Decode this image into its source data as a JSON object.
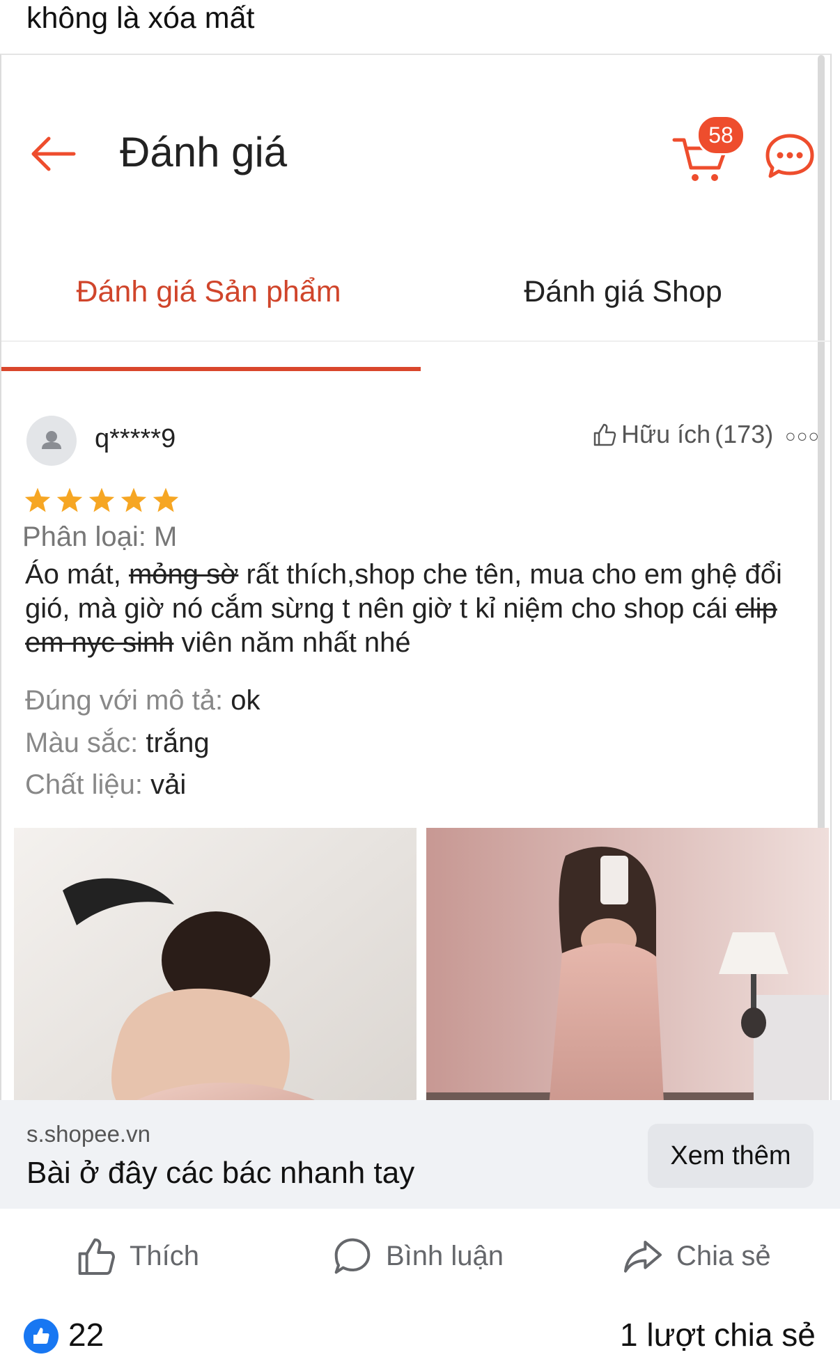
{
  "post": {
    "caption": "không là xóa mất"
  },
  "app": {
    "header_title": "Đánh giá",
    "cart_badge": "58",
    "accent_color": "#ee4d2d",
    "tabs": [
      {
        "label": "Đánh giá Sản phẩm",
        "active": true
      },
      {
        "label": "Đánh giá Shop",
        "active": false
      }
    ]
  },
  "review": {
    "username": "q*****9",
    "helpful_label": "Hữu ích",
    "helpful_count": "(173)",
    "rating": 5,
    "variant": "Phân loại: M",
    "comment": {
      "p1": "Áo mát, ",
      "s1": "mỏng sờ",
      "p2": " rất thích,shop che tên, mua cho em ghệ đổi gió, mà giờ nó cắm sừng t nên giờ t kỉ niệm cho shop cái ",
      "s2": "clip em nyc sinh",
      "p3": " viên năm nhất nhé"
    },
    "attributes": [
      {
        "label": "Đúng với mô tả: ",
        "value": "ok"
      },
      {
        "label": "Màu sắc: ",
        "value": "trắng"
      },
      {
        "label": "Chất liệu: ",
        "value": "vải"
      }
    ]
  },
  "link_preview": {
    "domain": "s.shopee.vn",
    "title": "Bài ở đây các bác nhanh tay",
    "see_more": "Xem thêm"
  },
  "actions": {
    "like": "Thích",
    "comment": "Bình luận",
    "share": "Chia sẻ"
  },
  "stats": {
    "likes": "22",
    "shares": "1 lượt chia sẻ"
  },
  "icons": [
    "back-arrow-icon",
    "cart-icon",
    "chat-icon",
    "thumbs-up-icon",
    "more-dots-icon",
    "star-icon",
    "comment-bubble-icon",
    "share-arrow-icon",
    "like-badge-icon",
    "user-avatar-icon"
  ]
}
